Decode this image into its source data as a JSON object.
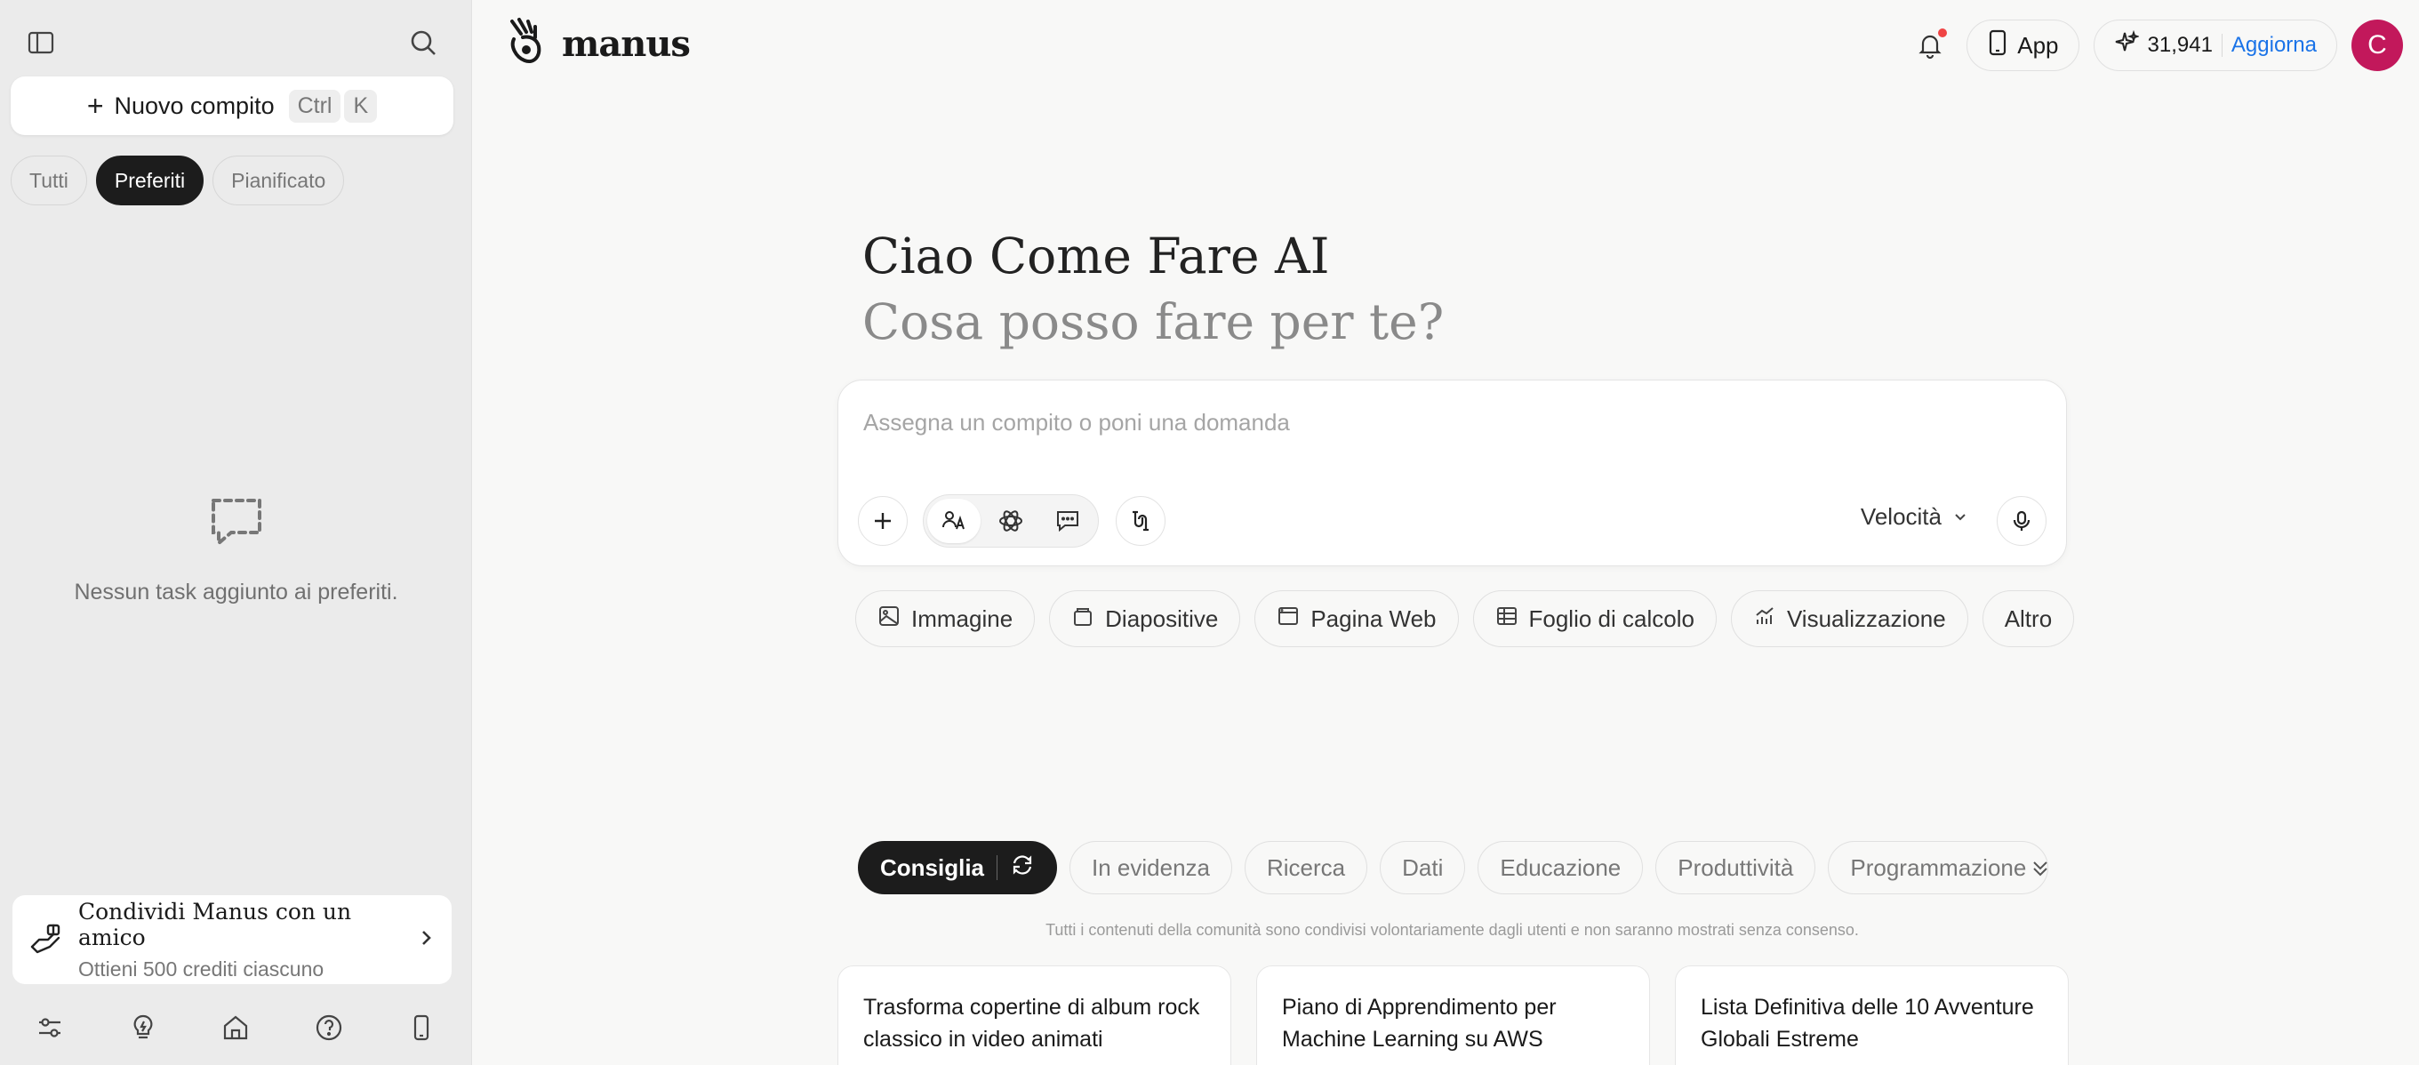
{
  "sidebar": {
    "new_task_label": "Nuovo compito",
    "shortcut_keys": [
      "Ctrl",
      "K"
    ],
    "filters": [
      {
        "label": "Tutti",
        "active": false
      },
      {
        "label": "Preferiti",
        "active": true
      },
      {
        "label": "Pianificato",
        "active": false
      }
    ],
    "empty_message": "Nessun task aggiunto ai preferiti.",
    "share": {
      "title": "Condividi Manus con un amico",
      "subtitle": "Ottieni 500 crediti ciascuno"
    },
    "bottom_icons": [
      "settings-sliders-icon",
      "lightbulb-icon",
      "home-icon",
      "help-icon",
      "mobile-icon"
    ]
  },
  "header": {
    "brand": "manus",
    "app_label": "App",
    "credits": "31,941",
    "upgrade_label": "Aggiorna",
    "avatar_initial": "C",
    "notification_dot": true
  },
  "main": {
    "greeting": "Ciao Come Fare AI",
    "subgreeting": "Cosa posso fare per te?",
    "composer": {
      "placeholder": "Assegna un compito o poni una domanda",
      "speed_label": "Velocità"
    },
    "quick_actions": [
      {
        "label": "Immagine",
        "icon": "image-icon"
      },
      {
        "label": "Diapositive",
        "icon": "slides-icon"
      },
      {
        "label": "Pagina Web",
        "icon": "browser-icon"
      },
      {
        "label": "Foglio di calcolo",
        "icon": "table-icon"
      },
      {
        "label": "Visualizzazione",
        "icon": "chart-icon"
      },
      {
        "label": "Altro",
        "icon": ""
      }
    ],
    "categories": [
      {
        "label": "Consiglia",
        "active": true
      },
      {
        "label": "In evidenza",
        "active": false
      },
      {
        "label": "Ricerca",
        "active": false
      },
      {
        "label": "Dati",
        "active": false
      },
      {
        "label": "Educazione",
        "active": false
      },
      {
        "label": "Produttività",
        "active": false
      },
      {
        "label": "Programmazione",
        "active": false
      }
    ],
    "disclaimer": "Tutti i contenuti della comunità sono condivisi volontariamente dagli utenti e non saranno mostrati senza consenso.",
    "cards": [
      "Trasforma copertine di album rock classico in video animati",
      "Piano di Apprendimento per Machine Learning su AWS",
      "Lista Definitiva delle 10 Avventure Globali Estreme"
    ]
  },
  "colors": {
    "accent": "#1a73e8",
    "avatar_bg": "#c2185b",
    "notification": "#ef4444",
    "dark_pill": "#1c1c1c"
  }
}
